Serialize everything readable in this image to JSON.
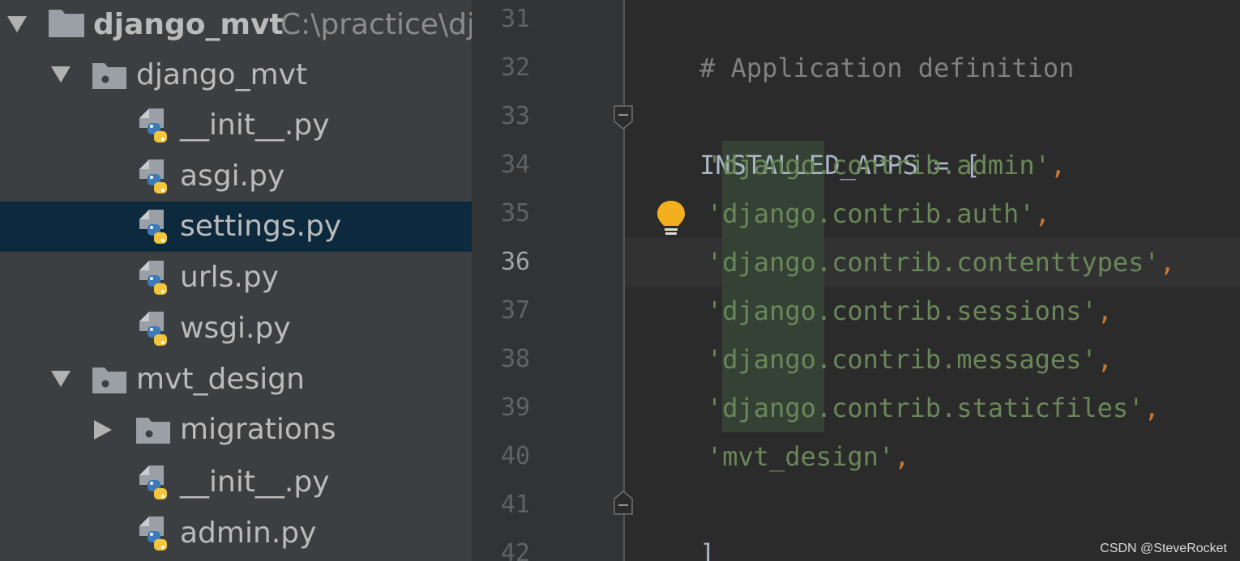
{
  "project_tree": {
    "root": {
      "name": "django_mvt",
      "path": "C:\\practice\\dja"
    },
    "items": [
      {
        "label": "django_mvt",
        "kind": "package",
        "expanded": true
      },
      {
        "label": "__init__.py",
        "kind": "python-file"
      },
      {
        "label": "asgi.py",
        "kind": "python-file"
      },
      {
        "label": "settings.py",
        "kind": "python-file",
        "selected": true
      },
      {
        "label": "urls.py",
        "kind": "python-file"
      },
      {
        "label": "wsgi.py",
        "kind": "python-file"
      },
      {
        "label": "mvt_design",
        "kind": "package",
        "expanded": true
      },
      {
        "label": "migrations",
        "kind": "package",
        "expanded": false
      },
      {
        "label": "__init__.py",
        "kind": "python-file"
      },
      {
        "label": "admin.py",
        "kind": "python-file"
      }
    ]
  },
  "editor": {
    "current_line": "36",
    "lines": [
      {
        "num": "31",
        "comment": "# Application definition"
      },
      {
        "num": "32"
      },
      {
        "num": "33",
        "code": "INSTALLED_APPS = ["
      },
      {
        "num": "34",
        "str_a": "'",
        "str_b": "django",
        "str_c": ".contrib.admin'",
        "punc": ","
      },
      {
        "num": "35",
        "str_a": "'",
        "str_b": "django",
        "str_c": ".contrib.auth'",
        "punc": ","
      },
      {
        "num": "36",
        "str_a": "'",
        "str_b": "django",
        "str_c": ".contrib.contenttypes'",
        "punc": ","
      },
      {
        "num": "37",
        "str_a": "'",
        "str_b": "django",
        "str_c": ".contrib.sessions'",
        "punc": ","
      },
      {
        "num": "38",
        "str_a": "'",
        "str_b": "django",
        "str_c": ".contrib.messages'",
        "punc": ","
      },
      {
        "num": "39",
        "str_a": "'",
        "str_b": "django",
        "str_c": ".contrib.staticfiles'",
        "punc": ","
      },
      {
        "num": "40",
        "str_a": "'mvt_design'",
        "punc": ","
      },
      {
        "num": "41",
        "code": "]"
      },
      {
        "num": "42"
      }
    ]
  },
  "icons": {
    "tree_expand": "triangle-down-icon",
    "tree_collapsed": "triangle-right-icon",
    "folder": "folder-icon",
    "package": "package-folder-icon",
    "python": "python-file-icon",
    "intention": "lightbulb-icon",
    "fold": "fold-marker-icon"
  },
  "colors": {
    "sidebar_bg": "#3c3f41",
    "selection": "#0d293e",
    "editor_bg": "#2b2b2b",
    "string": "#6a8759",
    "keyword_punct": "#cc7832",
    "comment": "#808080",
    "identifier": "#a9b7c6",
    "bulb": "#f2b01e"
  },
  "watermark": "CSDN @SteveRocket"
}
